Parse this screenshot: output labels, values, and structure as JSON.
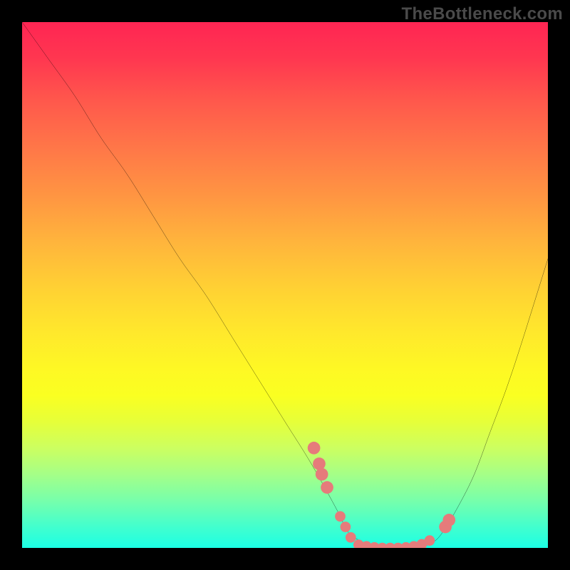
{
  "watermark": "TheBottleneck.com",
  "chart_data": {
    "type": "line",
    "title": "",
    "xlabel": "",
    "ylabel": "",
    "xlim": [
      0,
      100
    ],
    "ylim": [
      0,
      100
    ],
    "gradient_colors_top_to_bottom": [
      "#ff2553",
      "#ff584c",
      "#ff9542",
      "#ffd233",
      "#fef824",
      "#e6ff39",
      "#a5ff87",
      "#1cffe4"
    ],
    "curve": {
      "name": "bottleneck",
      "x": [
        0,
        5,
        10,
        15,
        20,
        25,
        30,
        35,
        40,
        45,
        50,
        55,
        60,
        62,
        65,
        68,
        72,
        75,
        78,
        80,
        83,
        86,
        89,
        92,
        95,
        100
      ],
      "y": [
        100,
        93,
        86,
        78,
        71,
        63,
        55,
        48,
        40,
        32,
        24,
        16,
        7,
        3,
        1,
        0,
        0,
        0,
        1,
        3,
        8,
        14,
        22,
        30,
        39,
        55
      ]
    },
    "markers": {
      "name": "highlighted-points",
      "color": "#e67b7b",
      "points": [
        {
          "x": 55.5,
          "y": 19.0,
          "r": 1.2
        },
        {
          "x": 56.5,
          "y": 16.0,
          "r": 1.2
        },
        {
          "x": 57.0,
          "y": 14.0,
          "r": 1.2
        },
        {
          "x": 58.0,
          "y": 11.5,
          "r": 1.2
        },
        {
          "x": 60.5,
          "y": 6.0,
          "r": 1.0
        },
        {
          "x": 61.5,
          "y": 4.0,
          "r": 1.0
        },
        {
          "x": 62.5,
          "y": 2.0,
          "r": 1.0
        },
        {
          "x": 64.0,
          "y": 0.6,
          "r": 1.0
        },
        {
          "x": 65.5,
          "y": 0.3,
          "r": 1.0
        },
        {
          "x": 67.0,
          "y": 0.1,
          "r": 1.0
        },
        {
          "x": 68.5,
          "y": 0.0,
          "r": 1.0
        },
        {
          "x": 70.0,
          "y": 0.0,
          "r": 1.0
        },
        {
          "x": 71.5,
          "y": 0.0,
          "r": 1.0
        },
        {
          "x": 73.0,
          "y": 0.1,
          "r": 1.0
        },
        {
          "x": 74.5,
          "y": 0.3,
          "r": 1.0
        },
        {
          "x": 76.0,
          "y": 0.7,
          "r": 1.0
        },
        {
          "x": 77.5,
          "y": 1.4,
          "r": 1.0
        },
        {
          "x": 80.5,
          "y": 4.0,
          "r": 1.2
        },
        {
          "x": 81.2,
          "y": 5.3,
          "r": 1.2
        }
      ]
    }
  }
}
